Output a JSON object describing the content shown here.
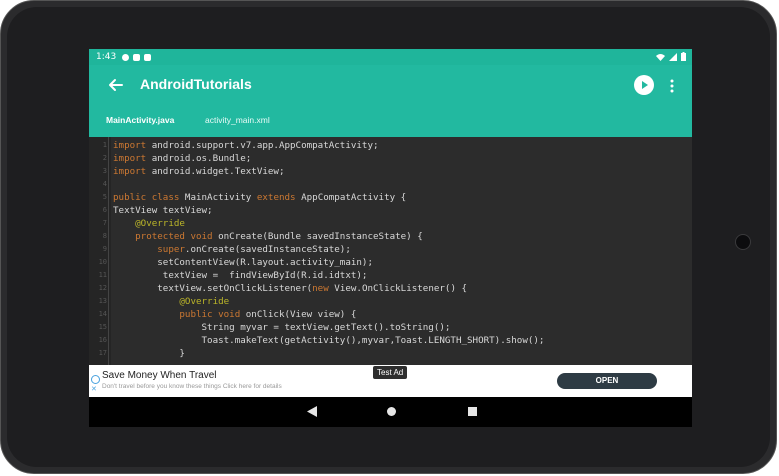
{
  "status_bar": {
    "time": "1:43"
  },
  "app_bar": {
    "title": "AndroidTutorials"
  },
  "tabs": [
    {
      "label": "MainActivity.java",
      "active": true
    },
    {
      "label": "activity_main.xml",
      "active": false
    }
  ],
  "code": {
    "line_numbers": [
      "1",
      "2",
      "3",
      "4",
      "5",
      "6",
      "7",
      "8",
      "9",
      "10",
      "11",
      "12",
      "13",
      "14",
      "15",
      "16",
      "17"
    ],
    "lines": [
      [
        {
          "t": "import ",
          "c": "kw"
        },
        {
          "t": "android.support.v7.app.AppCompatActivity;",
          "c": "tx"
        }
      ],
      [
        {
          "t": "import ",
          "c": "kw"
        },
        {
          "t": "android.os.Bundle;",
          "c": "tx"
        }
      ],
      [
        {
          "t": "import ",
          "c": "kw"
        },
        {
          "t": "android.widget.TextView;",
          "c": "tx"
        }
      ],
      [],
      [
        {
          "t": "public class ",
          "c": "kw"
        },
        {
          "t": "MainActivity ",
          "c": "tx"
        },
        {
          "t": "extends ",
          "c": "kw"
        },
        {
          "t": "AppCompatActivity {",
          "c": "tx"
        }
      ],
      [
        {
          "t": "TextView textView;",
          "c": "tx"
        }
      ],
      [
        {
          "t": "    @Override",
          "c": "an"
        }
      ],
      [
        {
          "t": "    protected void ",
          "c": "kw"
        },
        {
          "t": "onCreate(Bundle savedInstanceState) {",
          "c": "tx"
        }
      ],
      [
        {
          "t": "        super",
          "c": "kw"
        },
        {
          "t": ".onCreate(savedInstanceState);",
          "c": "tx"
        }
      ],
      [
        {
          "t": "        setContentView(R.layout.activity_main);",
          "c": "tx"
        }
      ],
      [
        {
          "t": "         textView =  findViewById(R.id.idtxt);",
          "c": "tx"
        }
      ],
      [
        {
          "t": "        textView.setOnClickListener(",
          "c": "tx"
        },
        {
          "t": "new ",
          "c": "kw"
        },
        {
          "t": "View.OnClickListener() {",
          "c": "tx"
        }
      ],
      [
        {
          "t": "            @Override",
          "c": "an"
        }
      ],
      [
        {
          "t": "            public void ",
          "c": "kw"
        },
        {
          "t": "onClick(View view) {",
          "c": "tx"
        }
      ],
      [
        {
          "t": "                String myvar = textView.getText().toString();",
          "c": "tx"
        }
      ],
      [
        {
          "t": "                Toast.makeText(getActivity(),myvar,Toast.LENGTH_SHORT).show();",
          "c": "tx"
        }
      ],
      [
        {
          "t": "            }",
          "c": "tx"
        }
      ]
    ]
  },
  "ad": {
    "title": "Save Money When Travel",
    "subtitle": "Don't travel before you know these things Click here for details",
    "button": "OPEN",
    "badge": "Test Ad"
  },
  "colors": {
    "status_bar": "#1fb59b",
    "app_bar": "#22b9a0",
    "editor_bg": "#2c2c2c",
    "keyword": "#cc7832",
    "annotation": "#bbb529",
    "text": "#d8d8d8"
  },
  "icons": {
    "status": [
      "settings-icon",
      "notification-icon",
      "sd-card-icon",
      "wifi-icon",
      "signal-icon",
      "battery-icon"
    ],
    "app_bar": [
      "back-arrow-icon",
      "play-icon",
      "more-vert-icon"
    ],
    "nav": [
      "nav-back-icon",
      "nav-home-icon",
      "nav-recents-icon"
    ]
  }
}
